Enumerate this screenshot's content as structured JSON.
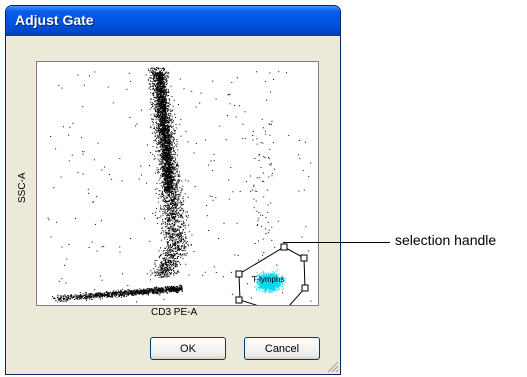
{
  "dialog": {
    "title": "Adjust Gate",
    "ok_label": "OK",
    "cancel_label": "Cancel"
  },
  "plot": {
    "x_axis_label": "CD3 PE-A",
    "y_axis_label": "SSC-A",
    "gate_label": "T-lymphs",
    "gate_color": "#00d8f0"
  },
  "annotation": {
    "text": "selection handle"
  },
  "colors": {
    "title_bar": "#0054e3",
    "dialog_bg": "#ece9d8",
    "dots": "#000000",
    "gate_fill": "#00d8f0"
  }
}
